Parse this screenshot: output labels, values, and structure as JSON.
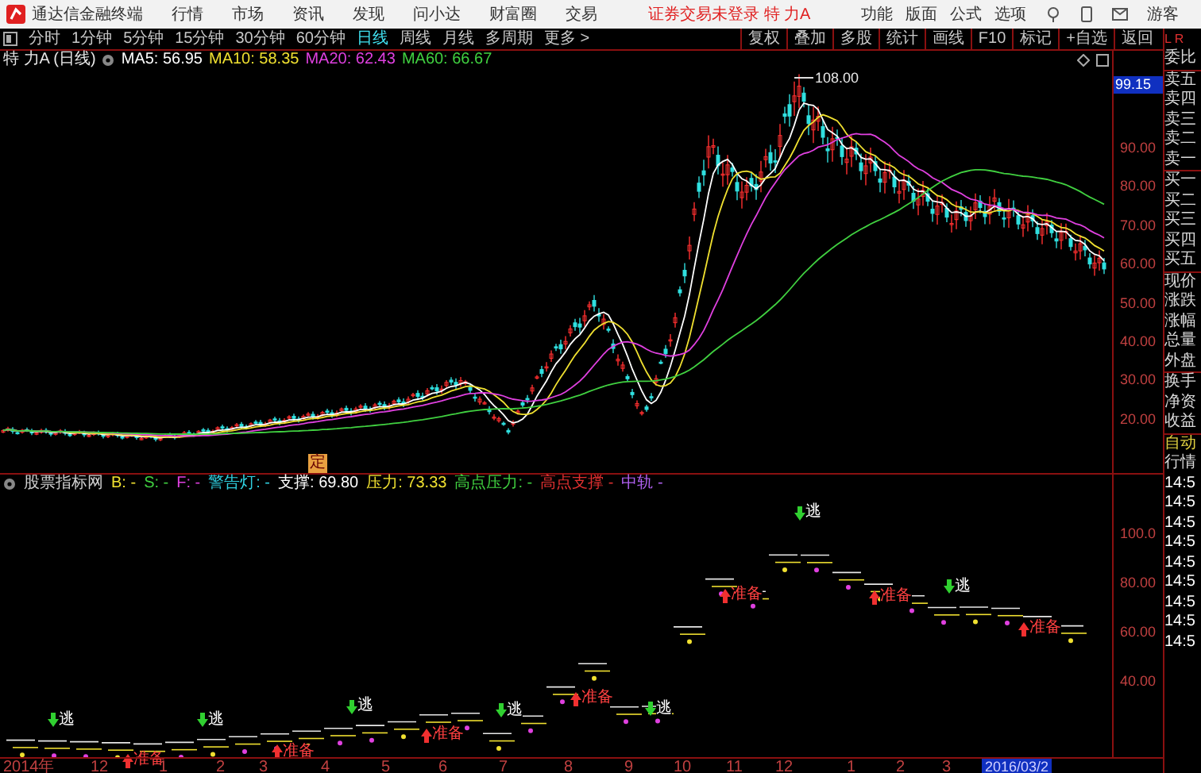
{
  "app": {
    "title": "通达信金融终端",
    "menus": [
      "行情",
      "市场",
      "资讯",
      "发现",
      "问小达",
      "财富圈",
      "交易"
    ],
    "notice": "证券交易未登录 特 力A",
    "right_menus": [
      "功能",
      "版面",
      "公式",
      "选项"
    ],
    "user": "游客"
  },
  "periods": [
    {
      "label": "分时",
      "selected": false
    },
    {
      "label": "1分钟",
      "selected": false
    },
    {
      "label": "5分钟",
      "selected": false
    },
    {
      "label": "15分钟",
      "selected": false
    },
    {
      "label": "30分钟",
      "selected": false
    },
    {
      "label": "60分钟",
      "selected": false
    },
    {
      "label": "日线",
      "selected": true
    },
    {
      "label": "周线",
      "selected": false
    },
    {
      "label": "月线",
      "selected": false
    },
    {
      "label": "多周期",
      "selected": false
    },
    {
      "label": "更多 >",
      "selected": false
    }
  ],
  "tools": [
    "复权",
    "叠加",
    "多股",
    "统计",
    "画线",
    "F10",
    "标记",
    "+自选",
    "返回"
  ],
  "legend": {
    "title": "特 力A (日线)",
    "items": [
      {
        "text": "MA5: 56.95",
        "color": "#ffffff"
      },
      {
        "text": "MA10: 58.35",
        "color": "#f0e030"
      },
      {
        "text": "MA20: 62.43",
        "color": "#e040e0"
      },
      {
        "text": "MA60: 66.67",
        "color": "#40d040"
      }
    ]
  },
  "main_chart": {
    "peak_label": "108.00",
    "marker": "定",
    "current_price": "99.15",
    "axis": [
      "90.00",
      "80.00",
      "70.00",
      "60.00",
      "50.00",
      "40.00",
      "30.00",
      "20.00"
    ]
  },
  "indicator": {
    "title": "股票指标网",
    "items": [
      {
        "text": "B: -",
        "color": "#f0e030"
      },
      {
        "text": "S: -",
        "color": "#40d040"
      },
      {
        "text": "F: -",
        "color": "#e040e0"
      },
      {
        "text": "警告灯: -",
        "color": "#30d0e0"
      },
      {
        "text": "支撑: 69.80",
        "color": "#ffffff"
      },
      {
        "text": "压力: 73.33",
        "color": "#f0e030"
      },
      {
        "text": "高点压力: -",
        "color": "#40d040"
      },
      {
        "text": "高点支撑 -",
        "color": "#e03030"
      },
      {
        "text": "中轨 -",
        "color": "#b060f0"
      }
    ],
    "axis": [
      "100.0",
      "80.00",
      "60.00",
      "40.00"
    ],
    "signals": [
      {
        "kind": "escape",
        "label": "逃"
      },
      {
        "kind": "prepare",
        "label": "准备"
      },
      {
        "kind": "escape",
        "label": "逃"
      },
      {
        "kind": "prepare",
        "label": "准备"
      },
      {
        "kind": "escape",
        "label": "逃"
      },
      {
        "kind": "prepare",
        "label": "准备"
      },
      {
        "kind": "escape",
        "label": "逃"
      },
      {
        "kind": "prepare",
        "label": "准备"
      },
      {
        "kind": "escape",
        "label": "逃"
      },
      {
        "kind": "prepare",
        "label": "准备"
      },
      {
        "kind": "escape",
        "label": "逃"
      },
      {
        "kind": "prepare",
        "label": "准备"
      },
      {
        "kind": "escape",
        "label": "逃"
      },
      {
        "kind": "prepare",
        "label": "准备"
      }
    ]
  },
  "time_axis": {
    "labels": [
      "2014年",
      "12",
      "1",
      "2",
      "3",
      "4",
      "5",
      "6",
      "7",
      "8",
      "9",
      "10",
      "11",
      "12",
      "1",
      "2",
      "3"
    ],
    "current": "2016/03/2"
  },
  "side_panel": {
    "corner": "L R",
    "labels": [
      "委比",
      "卖五",
      "卖四",
      "卖三",
      "卖二",
      "卖一",
      "买一",
      "买二",
      "买三",
      "买四",
      "买五",
      "现价",
      "涨跌",
      "涨幅",
      "总量",
      "外盘",
      "换手",
      "净资",
      "收益"
    ],
    "auto": "自动",
    "quote": "行情",
    "times": [
      "14:5",
      "14:5",
      "14:5",
      "14:5",
      "14:5",
      "14:5",
      "14:5",
      "14:5",
      "14:5"
    ]
  }
}
